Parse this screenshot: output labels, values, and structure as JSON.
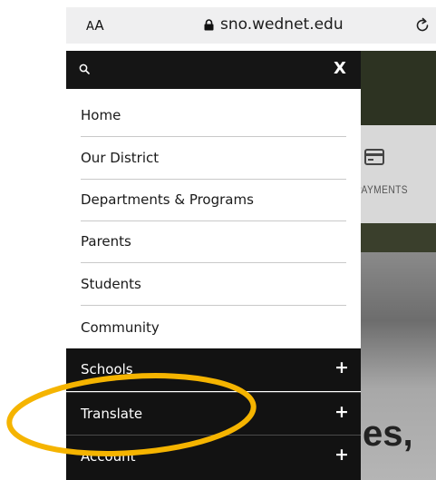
{
  "browser": {
    "text_size_label_small": "A",
    "text_size_label_big": "A",
    "domain": "sno.wednet.edu",
    "lock_icon": "lock-icon",
    "reload_icon": "reload-icon"
  },
  "search": {
    "placeholder": "",
    "close_label": "X",
    "icon": "search-icon"
  },
  "menu": {
    "items": [
      {
        "label": "Home"
      },
      {
        "label": "Our District"
      },
      {
        "label": "Departments & Programs"
      },
      {
        "label": "Parents"
      },
      {
        "label": "Students"
      },
      {
        "label": "Community"
      }
    ],
    "expandable": [
      {
        "label": "Schools",
        "toggle": "+"
      },
      {
        "label": "Translate",
        "toggle": "+"
      },
      {
        "label": "Account",
        "toggle": "+"
      }
    ]
  },
  "background_page": {
    "payments_label": "PAYMENTS",
    "headline_fragment": "es,"
  },
  "colors": {
    "menu_dark": "#121212",
    "annotation": "#f5b400"
  }
}
